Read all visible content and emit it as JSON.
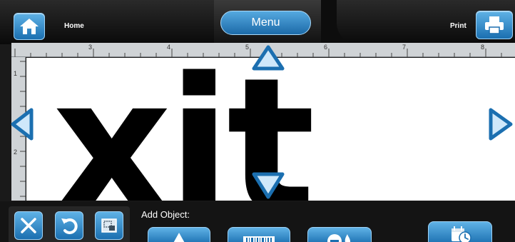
{
  "header": {
    "home_label": "Home",
    "menu_label": "Menu",
    "print_label": "Print"
  },
  "ruler": {
    "top_numbers": [
      "3",
      "4",
      "5",
      "6",
      "7",
      "8"
    ],
    "left_numbers": [
      "1",
      "2"
    ]
  },
  "label": {
    "text": "xit"
  },
  "bottom": {
    "add_object_label": "Add Object:"
  },
  "colors": {
    "button_blue": "#1b6fb0",
    "button_highlight": "#5fb2e6",
    "bar_dark": "#0d0d0d",
    "ruler_gray": "#cfd3d6"
  }
}
